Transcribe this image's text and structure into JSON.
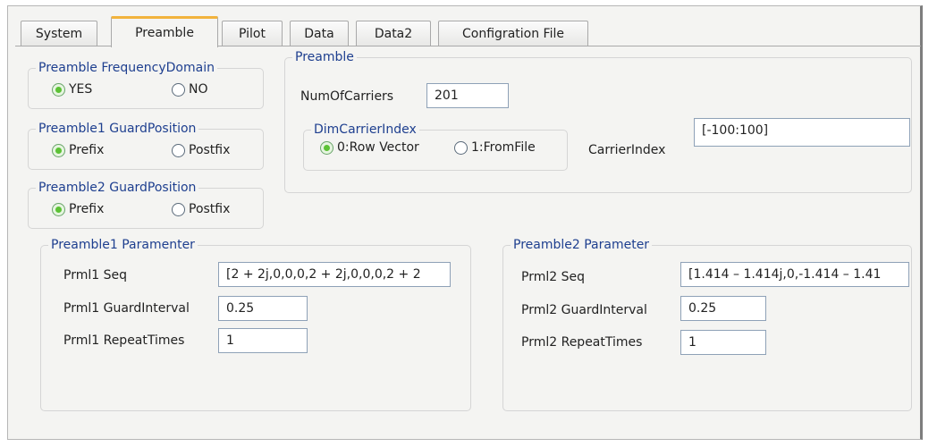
{
  "tabs": [
    {
      "label": "System"
    },
    {
      "label": "Preamble",
      "active": true
    },
    {
      "label": "Pilot"
    },
    {
      "label": "Data"
    },
    {
      "label": "Data2"
    },
    {
      "label": "Configration File"
    }
  ],
  "freq_domain": {
    "title": "Preamble FrequencyDomain",
    "yes": "YES",
    "no": "NO",
    "selected": "YES"
  },
  "guard1": {
    "title": "Preamble1 GuardPosition",
    "prefix": "Prefix",
    "postfix": "Postfix",
    "selected": "Prefix"
  },
  "guard2": {
    "title": "Preamble2 GuardPosition",
    "prefix": "Prefix",
    "postfix": "Postfix",
    "selected": "Prefix"
  },
  "preamble": {
    "title": "Preamble",
    "num_carriers_label": "NumOfCarriers",
    "num_carriers_value": "201",
    "dim_title": "DimCarrierIndex",
    "dim_row": "0:Row Vector",
    "dim_file": "1:FromFile",
    "dim_selected": "0:Row Vector",
    "carrier_index_label": "CarrierIndex",
    "carrier_index_value": "[-100:100]"
  },
  "p1": {
    "title": "Preamble1 Paramenter",
    "seq_label": "Prml1 Seq",
    "seq_value": "[2 + 2j,0,0,0,2 + 2j,0,0,0,2 + 2",
    "gi_label": "Prml1 GuardInterval",
    "gi_value": "0.25",
    "rt_label": "Prml1 RepeatTimes",
    "rt_value": "1"
  },
  "p2": {
    "title": "Preamble2 Parameter",
    "seq_label": "Prml2 Seq",
    "seq_value": "[1.414 – 1.414j,0,-1.414 – 1.41",
    "gi_label": "Prml2 GuardInterval",
    "gi_value": "0.25",
    "rt_label": "Prml2 RepeatTimes",
    "rt_value": "1"
  },
  "colors": {
    "accent_tab": "#f2b33d",
    "legend_text": "#1e3f8f",
    "radio_on": "#5cc235"
  }
}
